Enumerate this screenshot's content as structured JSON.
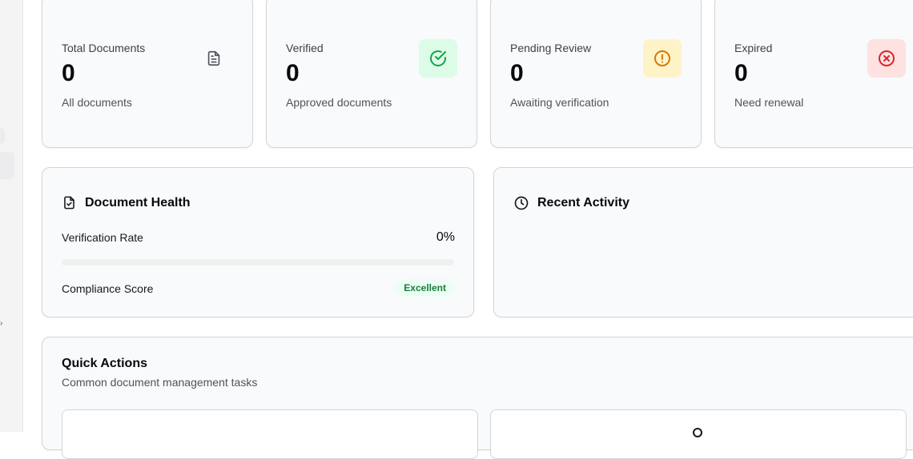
{
  "stats": [
    {
      "label": "Total Documents",
      "value": "0",
      "sub": "All documents",
      "icon": "file-text-icon",
      "icon_bg": "transparent",
      "icon_color": "#52525b"
    },
    {
      "label": "Verified",
      "value": "0",
      "sub": "Approved documents",
      "icon": "check-circle-icon",
      "icon_bg": "#dcfce7",
      "icon_color": "#16a34a"
    },
    {
      "label": "Pending Review",
      "value": "0",
      "sub": "Awaiting verification",
      "icon": "alert-circle-icon",
      "icon_bg": "#fef3c7",
      "icon_color": "#d97706"
    },
    {
      "label": "Expired",
      "value": "0",
      "sub": "Need renewal",
      "icon": "x-circle-icon",
      "icon_bg": "#fee2e2",
      "icon_color": "#dc2626"
    }
  ],
  "health": {
    "title": "Document Health",
    "icon": "file-check-icon",
    "verification_label": "Verification Rate",
    "verification_value": "0%",
    "verification_fraction": 0,
    "compliance_label": "Compliance Score",
    "compliance_badge": "Excellent"
  },
  "activity": {
    "title": "Recent Activity",
    "icon": "clock-icon"
  },
  "quick_actions": {
    "title": "Quick Actions",
    "subtitle": "Common document management tasks"
  }
}
